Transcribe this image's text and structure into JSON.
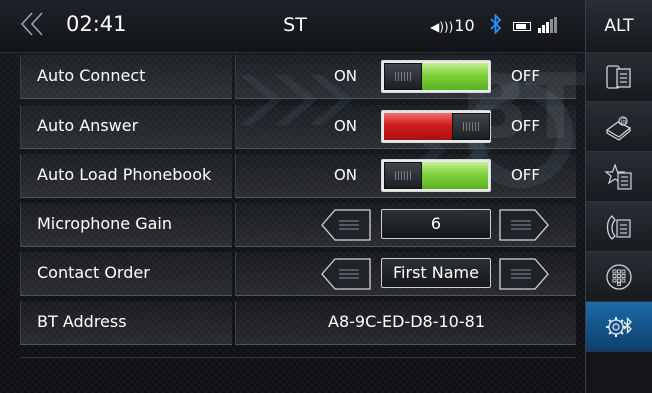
{
  "status_bar": {
    "back_icon": "double-chevron-left-icon",
    "time": "02:41",
    "source": "ST",
    "volume_icon": "speaker-icon",
    "volume": "10",
    "bluetooth_icon": "bluetooth-icon",
    "battery_icon": "battery-icon",
    "signal_icon": "signal-bars-icon"
  },
  "alt_button": "ALT",
  "sidebar": {
    "items": [
      {
        "icon": "phone-list-icon",
        "active": false
      },
      {
        "icon": "address-book-icon",
        "active": false
      },
      {
        "icon": "favorites-list-icon",
        "active": false
      },
      {
        "icon": "call-history-icon",
        "active": false
      },
      {
        "icon": "dial-pad-icon",
        "active": false
      },
      {
        "icon": "bluetooth-settings-icon",
        "active": true
      }
    ]
  },
  "watermark": "BT",
  "settings": {
    "auto_connect": {
      "label": "Auto Connect",
      "on_label": "ON",
      "off_label": "OFF",
      "state": "OFF"
    },
    "auto_answer": {
      "label": "Auto Answer",
      "on_label": "ON",
      "off_label": "OFF",
      "state": "ON"
    },
    "auto_load_phonebook": {
      "label": "Auto Load Phonebook",
      "on_label": "ON",
      "off_label": "OFF",
      "state": "OFF"
    },
    "microphone_gain": {
      "label": "Microphone Gain",
      "value": "6"
    },
    "contact_order": {
      "label": "Contact Order",
      "value": "First Name"
    },
    "bt_address": {
      "label": "BT Address",
      "value": "A8-9C-ED-D8-10-81"
    }
  },
  "colors": {
    "toggle_off_fill": "#7fd13b",
    "toggle_on_fill": "#d01c1c",
    "active_tab": "#1d6aa8"
  }
}
